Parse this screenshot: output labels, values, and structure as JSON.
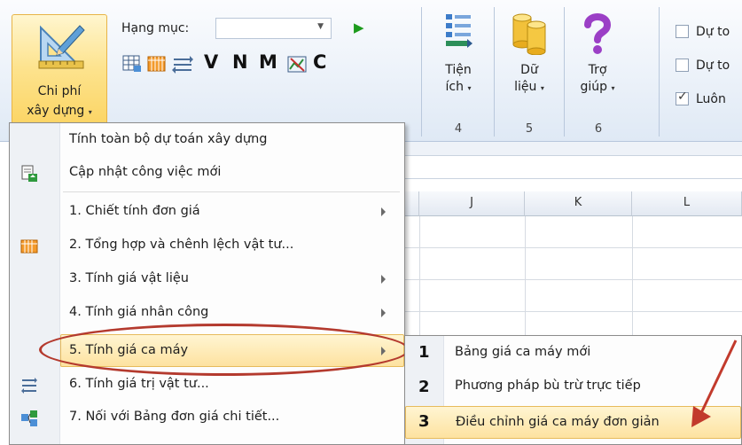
{
  "ribbon": {
    "chi_phi": {
      "line1": "Chi phí",
      "line2": "xây dựng",
      "icon": "ruler-set-pencil-icon"
    },
    "hang_muc": {
      "label": "Hạng mục:",
      "value": ""
    },
    "toolbar_letters": [
      "V",
      "N",
      "M",
      "C"
    ],
    "tien_ich": {
      "line1": "Tiện",
      "line2": "ích",
      "group_number": "4"
    },
    "du_lieu": {
      "line1": "Dữ",
      "line2": "liệu",
      "group_number": "5"
    },
    "tro_giup": {
      "line1": "Trợ",
      "line2": "giúp",
      "group_number": "6"
    },
    "checkboxes": [
      {
        "label": "Dự to",
        "checked": false
      },
      {
        "label": "Dự to",
        "checked": false
      },
      {
        "label": "Luôn",
        "checked": true
      }
    ]
  },
  "sheet": {
    "columns": [
      "J",
      "K",
      "L"
    ]
  },
  "menu": {
    "items": [
      {
        "label": "Tính toàn bộ dự toán xây dựng"
      },
      {
        "label": "Cập nhật công việc mới"
      },
      {
        "label": "1. Chiết tính đơn giá"
      },
      {
        "label": "2. Tổng hợp và chênh lệch vật tư..."
      },
      {
        "label": "3. Tính giá vật liệu"
      },
      {
        "label": "4. Tính giá nhân công"
      },
      {
        "label": "5. Tính giá ca máy"
      },
      {
        "label": "6. Tính giá trị vật tư..."
      },
      {
        "label": "7. Nối với Bảng đơn giá chi tiết..."
      }
    ]
  },
  "submenu": {
    "items": [
      {
        "number": "1",
        "label": "Bảng giá ca máy mới"
      },
      {
        "number": "2",
        "label": "Phương pháp bù trừ trực tiếp"
      },
      {
        "number": "3",
        "label": "Điều chỉnh giá ca máy đơn giản"
      }
    ]
  },
  "colors": {
    "highlight": "#fde2a0",
    "annotation": "#b43a2e"
  }
}
